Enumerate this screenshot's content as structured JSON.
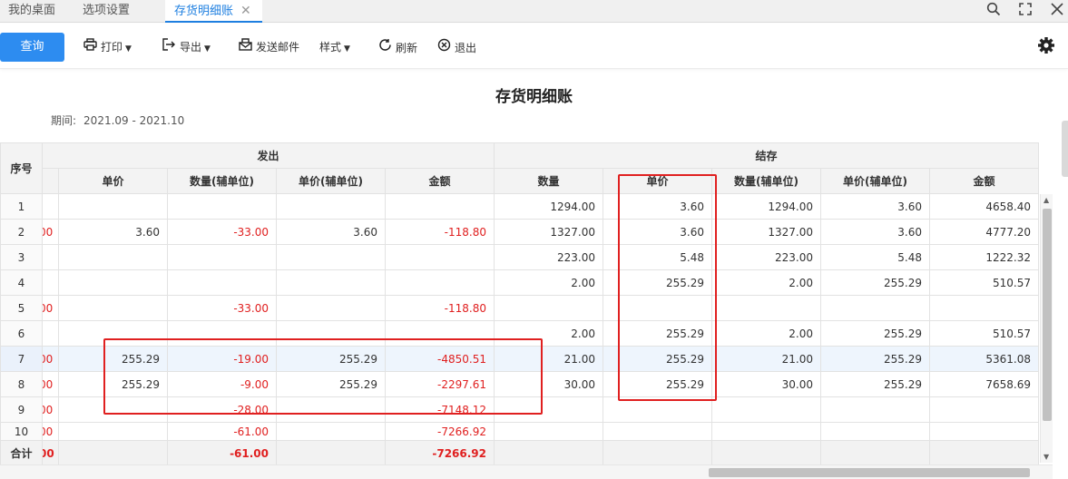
{
  "tabs": [
    {
      "label": "我的桌面",
      "active": false
    },
    {
      "label": "选项设置",
      "active": false
    },
    {
      "label": "存货明细账",
      "active": true
    }
  ],
  "tab_close": "✕",
  "window_icons": {
    "search": "search-icon",
    "fullscreen": "fullscreen-icon",
    "close": "close-icon"
  },
  "toolbar": {
    "query": "查询",
    "print": "打印",
    "export": "导出",
    "email": "发送邮件",
    "style": "样式",
    "refresh": "刷新",
    "exit": "退出"
  },
  "report": {
    "title": "存货明细账",
    "period_label": "期间:",
    "period_value": "2021.09 - 2021.10"
  },
  "table": {
    "seq_header": "序号",
    "group_out": "发出",
    "group_balance": "结存",
    "columns": [
      "单价",
      "数量(辅单位)",
      "单价(辅单位)",
      "金额",
      "数量",
      "单价",
      "数量(辅单位)",
      "单价(辅单位)",
      "金额"
    ],
    "rows": [
      {
        "seq": "1",
        "cut": "",
        "out_price": "",
        "out_qty_aux": "",
        "out_price_aux": "",
        "out_amount": "",
        "bal_qty": "1294.00",
        "bal_price": "3.60",
        "bal_qty_aux": "1294.00",
        "bal_price_aux": "3.60",
        "bal_amount": "4658.40"
      },
      {
        "seq": "2",
        "cut": "00",
        "out_price": "3.60",
        "out_qty_aux": "-33.00",
        "out_price_aux": "3.60",
        "out_amount": "-118.80",
        "bal_qty": "1327.00",
        "bal_price": "3.60",
        "bal_qty_aux": "1327.00",
        "bal_price_aux": "3.60",
        "bal_amount": "4777.20"
      },
      {
        "seq": "3",
        "cut": "",
        "out_price": "",
        "out_qty_aux": "",
        "out_price_aux": "",
        "out_amount": "",
        "bal_qty": "223.00",
        "bal_price": "5.48",
        "bal_qty_aux": "223.00",
        "bal_price_aux": "5.48",
        "bal_amount": "1222.32"
      },
      {
        "seq": "4",
        "cut": "",
        "out_price": "",
        "out_qty_aux": "",
        "out_price_aux": "",
        "out_amount": "",
        "bal_qty": "2.00",
        "bal_price": "255.29",
        "bal_qty_aux": "2.00",
        "bal_price_aux": "255.29",
        "bal_amount": "510.57"
      },
      {
        "seq": "5",
        "cut": "00",
        "out_price": "",
        "out_qty_aux": "-33.00",
        "out_price_aux": "",
        "out_amount": "-118.80",
        "bal_qty": "",
        "bal_price": "",
        "bal_qty_aux": "",
        "bal_price_aux": "",
        "bal_amount": ""
      },
      {
        "seq": "6",
        "cut": "",
        "out_price": "",
        "out_qty_aux": "",
        "out_price_aux": "",
        "out_amount": "",
        "bal_qty": "2.00",
        "bal_price": "255.29",
        "bal_qty_aux": "2.00",
        "bal_price_aux": "255.29",
        "bal_amount": "510.57"
      },
      {
        "seq": "7",
        "cut": "00",
        "out_price": "255.29",
        "out_qty_aux": "-19.00",
        "out_price_aux": "255.29",
        "out_amount": "-4850.51",
        "bal_qty": "21.00",
        "bal_price": "255.29",
        "bal_qty_aux": "21.00",
        "bal_price_aux": "255.29",
        "bal_amount": "5361.08"
      },
      {
        "seq": "8",
        "cut": "00",
        "out_price": "255.29",
        "out_qty_aux": "-9.00",
        "out_price_aux": "255.29",
        "out_amount": "-2297.61",
        "bal_qty": "30.00",
        "bal_price": "255.29",
        "bal_qty_aux": "30.00",
        "bal_price_aux": "255.29",
        "bal_amount": "7658.69"
      },
      {
        "seq": "9",
        "cut": "00",
        "out_price": "",
        "out_qty_aux": "-28.00",
        "out_price_aux": "",
        "out_amount": "-7148.12",
        "bal_qty": "",
        "bal_price": "",
        "bal_qty_aux": "",
        "bal_price_aux": "",
        "bal_amount": ""
      },
      {
        "seq": "10",
        "cut": "00",
        "out_price": "",
        "out_qty_aux": "-61.00",
        "out_price_aux": "",
        "out_amount": "-7266.92",
        "bal_qty": "",
        "bal_price": "",
        "bal_qty_aux": "",
        "bal_price_aux": "",
        "bal_amount": ""
      }
    ],
    "total": {
      "seq": "合计",
      "cut": "00",
      "out_qty_aux": "-61.00",
      "out_amount": "-7266.92"
    }
  },
  "colors": {
    "accent": "#2d8cf0",
    "negative": "#e02020",
    "annotation": "#e02020"
  }
}
